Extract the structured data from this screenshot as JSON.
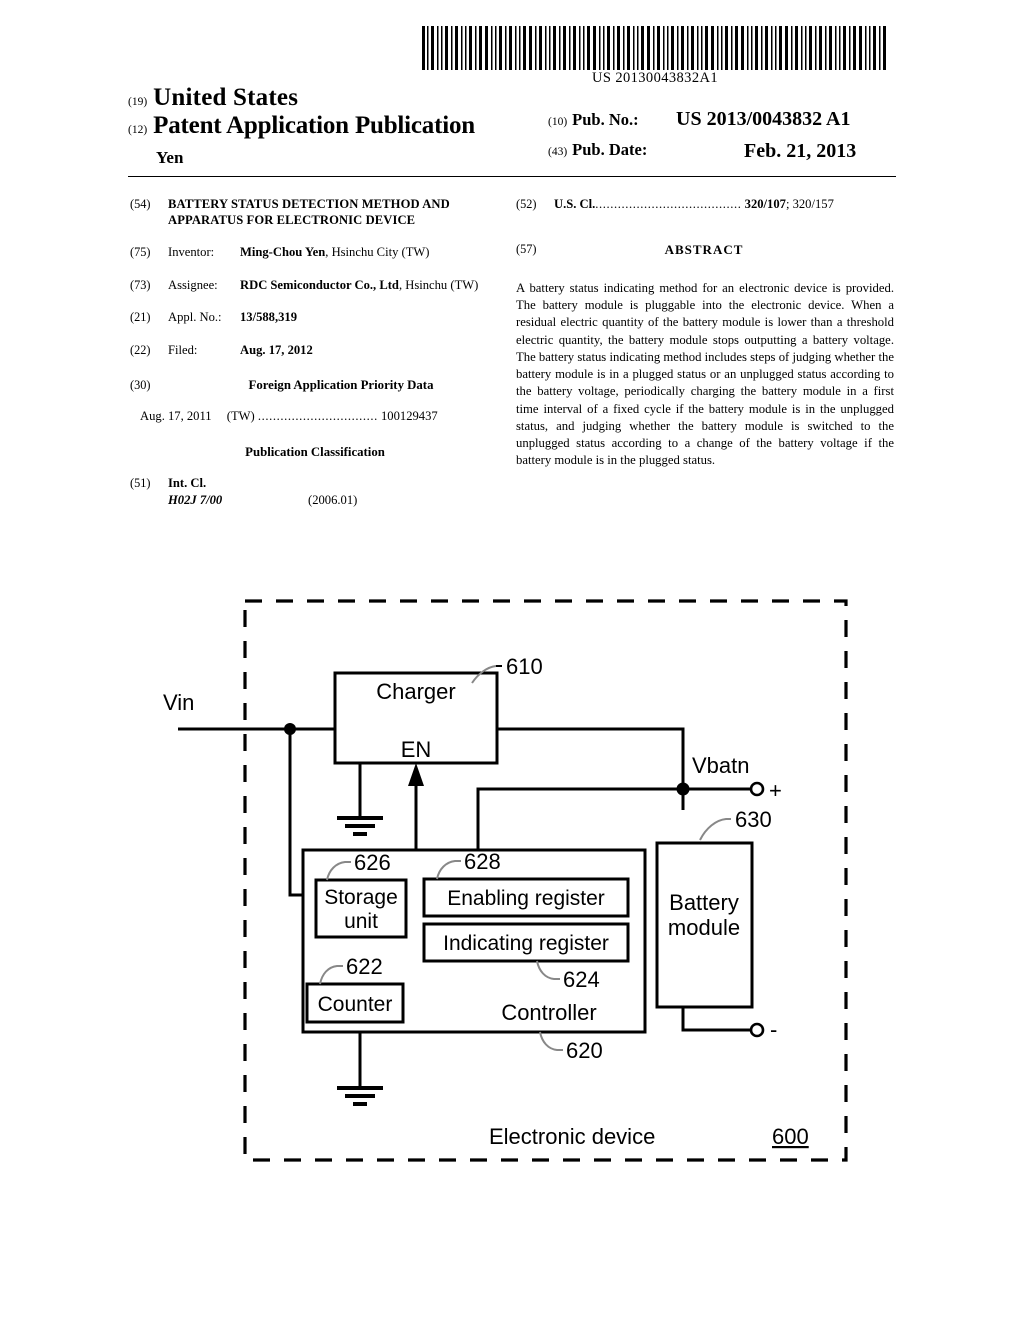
{
  "barcode": {
    "number": "US 20130043832A1"
  },
  "header": {
    "tag_19": "(19)",
    "country": "United States",
    "tag_12": "(12)",
    "doc_type": "Patent Application Publication",
    "inventor_surname": "Yen",
    "tag_10": "(10)",
    "pub_no_label": "Pub. No.:",
    "pub_no_value": "US 2013/0043832 A1",
    "tag_43": "(43)",
    "pub_date_label": "Pub. Date:",
    "pub_date_value": "Feb. 21, 2013"
  },
  "left_column": {
    "title": {
      "num": "(54)",
      "text": "BATTERY STATUS DETECTION METHOD AND APPARATUS FOR ELECTRONIC DEVICE"
    },
    "inventor": {
      "num": "(75)",
      "key": "Inventor:",
      "name": "Ming-Chou Yen",
      "rest": ", Hsinchu City (TW)"
    },
    "assignee": {
      "num": "(73)",
      "key": "Assignee:",
      "name": "RDC Semiconductor Co., Ltd",
      "rest": ", Hsinchu (TW)"
    },
    "appl_no": {
      "num": "(21)",
      "key": "Appl. No.:",
      "value": "13/588,319"
    },
    "filed": {
      "num": "(22)",
      "key": "Filed:",
      "value": "Aug. 17, 2012"
    },
    "foreign": {
      "num": "(30)",
      "heading": "Foreign Application Priority Data",
      "date": "Aug. 17, 2011",
      "country": "(TW)",
      "dots": "................................",
      "number": "100129437"
    },
    "pub_classification_heading": "Publication Classification",
    "int_cl": {
      "num": "(51)",
      "key": "Int. Cl.",
      "code": "H02J 7/00",
      "version": "(2006.01)"
    }
  },
  "right_column": {
    "us_cl": {
      "num": "(52)",
      "key": "U.S. Cl.",
      "dots": ".......................................",
      "primary": "320/107",
      "secondary": "; 320/157"
    },
    "abstract": {
      "num": "(57)",
      "heading": "ABSTRACT",
      "text": "A battery status indicating method for an electronic device is provided. The battery module is pluggable into the electronic device. When a residual electric quantity of the battery module is lower than a threshold electric quantity, the battery module stops outputting a battery voltage. The battery status indicating method includes steps of judging whether the battery module is in a plugged status or an unplugged status according to the battery voltage, periodically charging the battery module in a first time interval of a fixed cycle if the battery module is in the unplugged status, and judging whether the battery module is switched to the unplugged status according to a change of the battery voltage if the battery module is in the plugged status."
    }
  },
  "figure": {
    "vin_label": "Vin",
    "charger_label": "Charger",
    "charger_en_label": "EN",
    "charger_ref": "610",
    "vbatn_label": "Vbatn",
    "terminal_plus": "+",
    "terminal_minus": "-",
    "battery_module_line1": "Battery",
    "battery_module_line2": "module",
    "battery_module_ref": "630",
    "storage_unit_line1": "Storage",
    "storage_unit_line2": "unit",
    "storage_unit_ref": "626",
    "enabling_register_label": "Enabling register",
    "enabling_register_ref": "628",
    "indicating_register_label": "Indicating register",
    "indicating_register_ref": "624",
    "counter_label": "Counter",
    "counter_ref": "622",
    "controller_label": "Controller",
    "controller_ref": "620",
    "electronic_device_label": "Electronic device",
    "electronic_device_ref": "600"
  }
}
